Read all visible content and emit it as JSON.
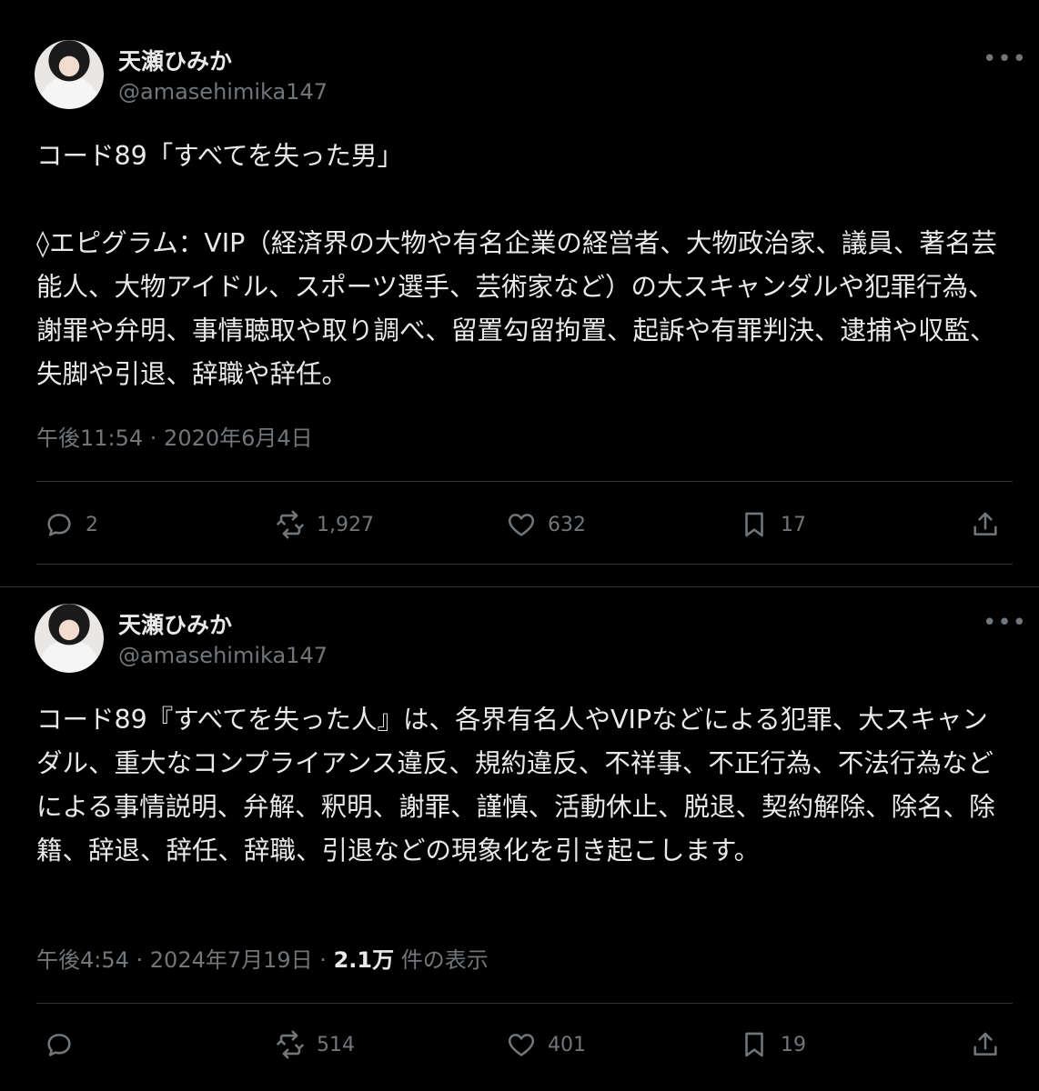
{
  "tweets": [
    {
      "author": {
        "name": "天瀬ひみか",
        "handle": "@amasehimika147"
      },
      "body": [
        "コード89「すべてを失った男」",
        "◊エピグラム：VIP（経済界の大物や有名企業の経営者、大物政治家、議員、著名芸能人、大物アイドル、スポーツ選手、芸術家など）の大スキャンダルや犯罪行為、謝罪や弁明、事情聴取や取り調べ、留置勾留拘置、起訴や有罪判決、逮捕や収監、失脚や引退、辞職や辞任。"
      ],
      "timestamp": "午後11:54 · 2020年6月4日",
      "views_count": "",
      "views_label": "",
      "replies": "2",
      "retweets": "1,927",
      "likes": "632",
      "bookmarks": "17"
    },
    {
      "author": {
        "name": "天瀬ひみか",
        "handle": "@amasehimika147"
      },
      "body": [
        "コード89『すべてを失った人』は、各界有名人やVIPなどによる犯罪、大スキャンダル、重大なコンプライアンス違反、規約違反、不祥事、不正行為、不法行為などによる事情説明、弁解、釈明、謝罪、謹慎、活動休止、脱退、契約解除、除名、除籍、辞退、辞任、辞職、引退などの現象化を引き起こします。"
      ],
      "timestamp": "午後4:54 · 2024年7月19日 · ",
      "views_count": "2.1万",
      "views_label": " 件の表示",
      "replies": "",
      "retweets": "514",
      "likes": "401",
      "bookmarks": "19"
    }
  ],
  "more_icon": "more-horizontal-icon",
  "colors": {
    "background": "#000000",
    "text": "#e7e9ea",
    "secondary": "#71767b",
    "divider": "#2f3336"
  }
}
